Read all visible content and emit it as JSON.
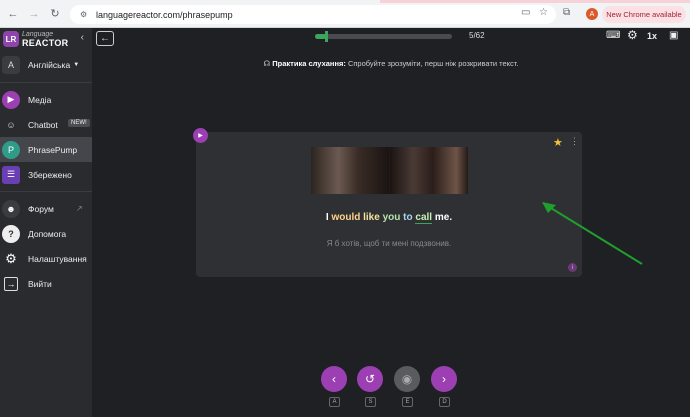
{
  "browser": {
    "url": "languagereactor.com/phrasepump",
    "update_label": "New Chrome available",
    "profile_initial": "A"
  },
  "sidebar": {
    "logo_initials": "LR",
    "logo_top": "Language",
    "logo_bottom": "REACTOR",
    "language_badge": "A",
    "language_label": "Англійська",
    "items": [
      {
        "label": "Медіа",
        "color": "#9c3fb3"
      },
      {
        "label": "Chatbot",
        "badge": "NEW!"
      },
      {
        "label": "PhrasePump",
        "color": "#2f9c8a"
      },
      {
        "label": "Збережено",
        "color": "#6a3fb3"
      },
      {
        "label": "Форум"
      },
      {
        "label": "Допомога"
      },
      {
        "label": "Налаштування"
      },
      {
        "label": "Вийти"
      }
    ]
  },
  "header": {
    "progress_text": "5/62",
    "progress_fraction": 0.081,
    "speed_label": "1x"
  },
  "hint": {
    "title": "Практика слухання:",
    "text": "Спробуйте зрозуміти, перш ніж розкривати текст."
  },
  "card": {
    "subtitle_words": [
      "I",
      "would",
      "like",
      "you",
      "to",
      "call",
      "me."
    ],
    "translation": "Я б хотів, щоб ти мені подзвонив."
  },
  "controls": {
    "keys": [
      "A",
      "S",
      "E",
      "D"
    ]
  },
  "colors": {
    "accent": "#9c3fb3",
    "progress": "#3ba55c",
    "arrow": "#1fa02e"
  }
}
